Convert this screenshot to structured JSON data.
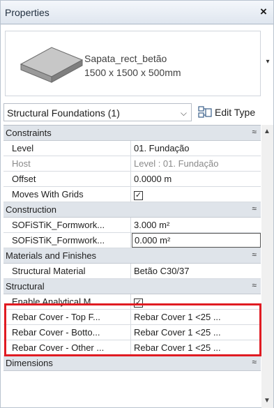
{
  "titlebar": {
    "title": "Properties",
    "close_glyph": "×"
  },
  "type_selector": {
    "icon": "foundation-block-thumbnail",
    "name": "Sapata_rect_betão",
    "size": "1500 x 1500 x 500mm",
    "dropdown_glyph": "▾"
  },
  "instance_selector": {
    "label": "Structural Foundations (1)",
    "arrow_glyph": "⌵",
    "edit_type_label": "Edit Type",
    "edit_type_icon": "edit-type-icon"
  },
  "groups": [
    {
      "name": "Constraints",
      "toggle": "≈",
      "params": [
        {
          "name": "Level",
          "value": "01. Fundação"
        },
        {
          "name": "Host",
          "value": "Level : 01. Fundação",
          "readonly": true
        },
        {
          "name": "Offset",
          "value": "0.0000 m"
        },
        {
          "name": "Moves With Grids",
          "checkbox": true
        }
      ]
    },
    {
      "name": "Construction",
      "toggle": "≈",
      "params": [
        {
          "name": "SOFiSTiK_Formwork...",
          "value": "3.000 m²"
        },
        {
          "name": "SOFiSTiK_Formwork...",
          "value": "0.000 m²",
          "editing": true
        }
      ]
    },
    {
      "name": "Materials and Finishes",
      "toggle": "≈",
      "params": [
        {
          "name": "Structural Material",
          "value": "Betão C30/37"
        }
      ]
    },
    {
      "name": "Structural",
      "toggle": "≈",
      "params": [
        {
          "name": "Enable Analytical M...",
          "checkbox": true
        },
        {
          "name": "Rebar Cover - Top F...",
          "value": "Rebar Cover 1 <25 ..."
        },
        {
          "name": "Rebar Cover - Botto...",
          "value": "Rebar Cover 1 <25 ..."
        },
        {
          "name": "Rebar Cover - Other ...",
          "value": "Rebar Cover 1 <25 ..."
        }
      ]
    },
    {
      "name": "Dimensions",
      "toggle": "≈",
      "params": []
    }
  ],
  "checkbox_glyph": "✓",
  "scrollbar": {
    "up_glyph": "▲",
    "down_glyph": "▼"
  },
  "colors": {
    "highlight": "#e01b22",
    "group_bg": "#dfe4ea",
    "readonly_text": "#8a8a8a"
  }
}
